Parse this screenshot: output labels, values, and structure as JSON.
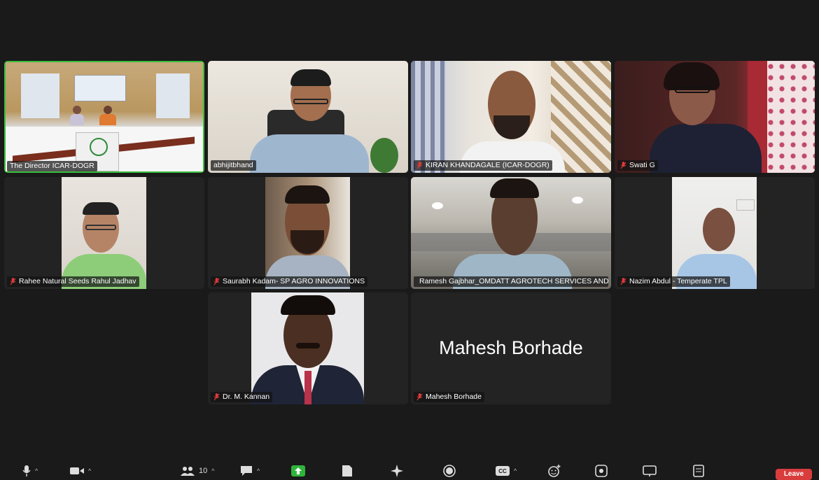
{
  "participants": [
    {
      "name": "The Director ICAR-DOGR",
      "muted": false,
      "active": true
    },
    {
      "name": "abhijitbhand",
      "muted": false
    },
    {
      "name": "KIRAN KHANDAGALE (ICAR-DOGR)",
      "muted": true
    },
    {
      "name": "Swati G",
      "muted": true
    },
    {
      "name": "Rahee Natural Seeds Rahul Jadhav",
      "muted": true
    },
    {
      "name": "Saurabh Kadam- SP AGRO INNOVATIONS",
      "muted": true
    },
    {
      "name": "Ramesh Gajbhar_OMDATT AGROTECH SERVICES AND...",
      "muted": true
    },
    {
      "name": "Nazim Abdul - Temperate TPL",
      "muted": true
    },
    {
      "name": "Dr. M. Kannan",
      "muted": true
    },
    {
      "name": "Mahesh Borhade",
      "muted": true,
      "video_off_label": "Mahesh Borhade"
    }
  ],
  "toolbar": {
    "participants_count": "10",
    "leave_label": "Leave"
  },
  "colors": {
    "active_border": "#3bbf3b",
    "leave": "#d93c3c",
    "mute_icon": "#e03a3a"
  }
}
